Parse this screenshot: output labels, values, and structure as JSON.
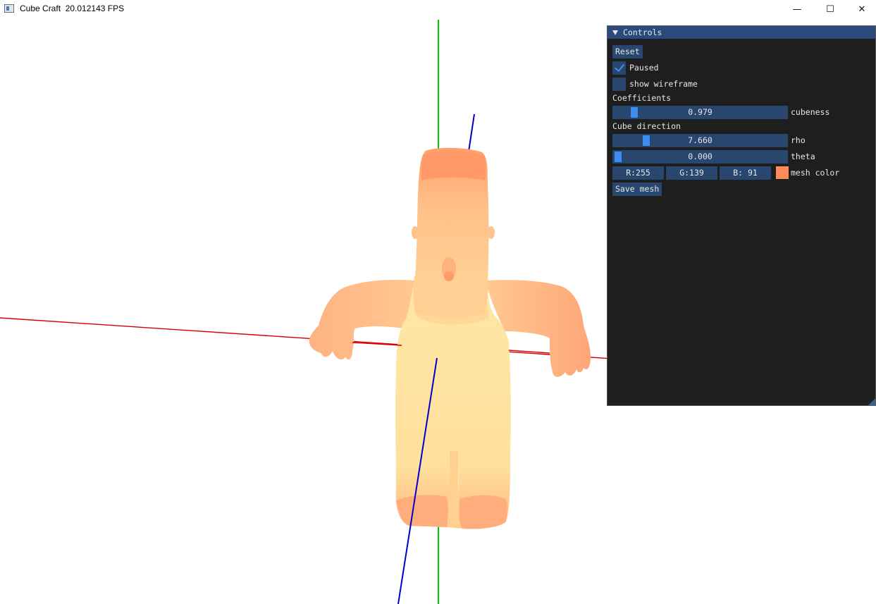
{
  "window": {
    "title": "Cube Craft  20.012143 FPS",
    "minimize_glyph": "—",
    "maximize_glyph": "☐",
    "close_glyph": "✕"
  },
  "controls": {
    "title": "Controls",
    "reset_label": "Reset",
    "paused": {
      "label": "Paused",
      "checked": true
    },
    "wireframe": {
      "label": "show wireframe",
      "checked": false
    },
    "coefficients_heading": "Coefficients",
    "cubeness": {
      "value": "0.979",
      "label": "cubeness"
    },
    "cube_direction_heading": "Cube direction",
    "rho": {
      "value": "7.660",
      "label": "rho"
    },
    "theta": {
      "value": "0.000",
      "label": "theta"
    },
    "mesh_color": {
      "r": "R:255",
      "g": "G:139",
      "b": "B: 91",
      "label": "mesh color",
      "hex": "#ff8b5b"
    },
    "save_label": "Save mesh"
  },
  "colors": {
    "x_axis": "#d60000",
    "y_axis": "#00c800",
    "z_axis": "#0000c8",
    "mesh_light": "#ffe39a",
    "mesh_main": "#ffc792",
    "mesh_dark": "#ff8b5b"
  }
}
